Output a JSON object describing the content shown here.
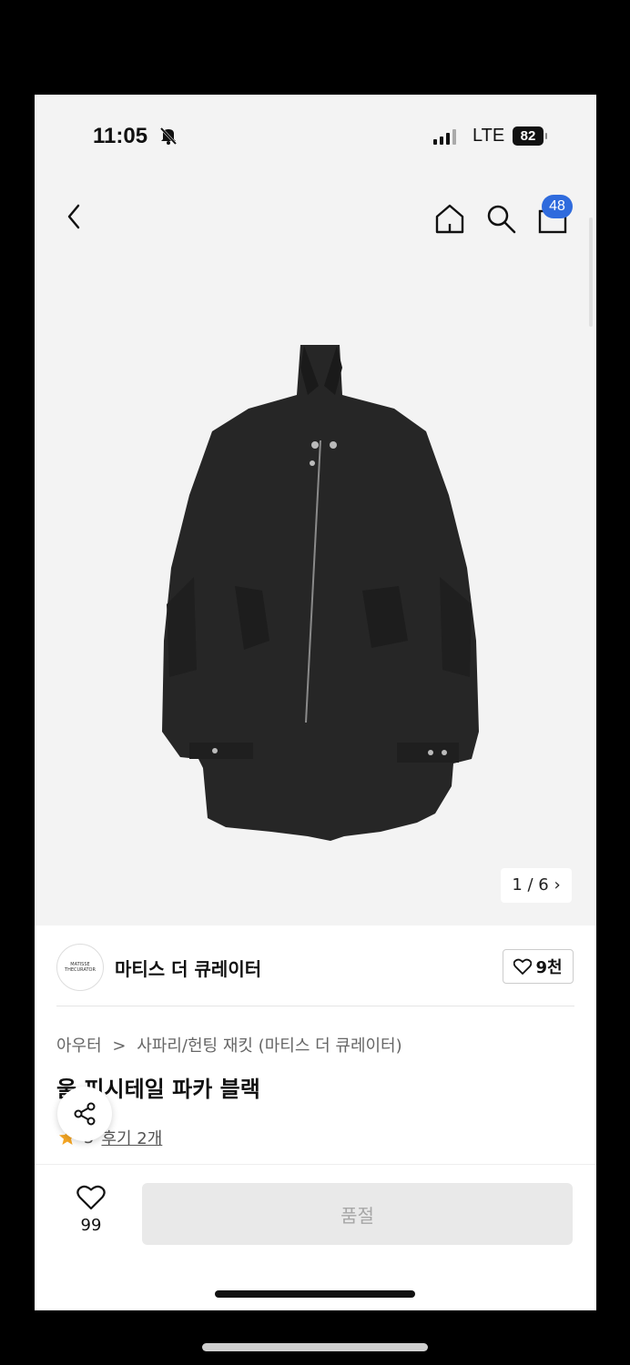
{
  "status_bar": {
    "time": "11:05",
    "network": "LTE",
    "battery": "82"
  },
  "nav": {
    "cart_count": "48"
  },
  "gallery": {
    "counter": "1 / 6 ›"
  },
  "brand": {
    "name": "마티스 더 큐레이터",
    "logo_line1": "MATISSE",
    "logo_line2": "THECURATOR",
    "likes": "9천"
  },
  "product": {
    "breadcrumb": [
      "아우터",
      "사파리/헌팅 재킷 (마티스 더 큐레이터)"
    ],
    "breadcrumb_sep": ">",
    "title": "울 피시테일 파카 블랙",
    "rating_value": "5",
    "reviews": "후기 2개"
  },
  "bottom_bar": {
    "wish_count": "99",
    "soldout_label": "품절"
  },
  "colors": {
    "accent_badge": "#2f6bdd",
    "star": "#f5a623",
    "button_disabled": "#e9e9e9"
  }
}
